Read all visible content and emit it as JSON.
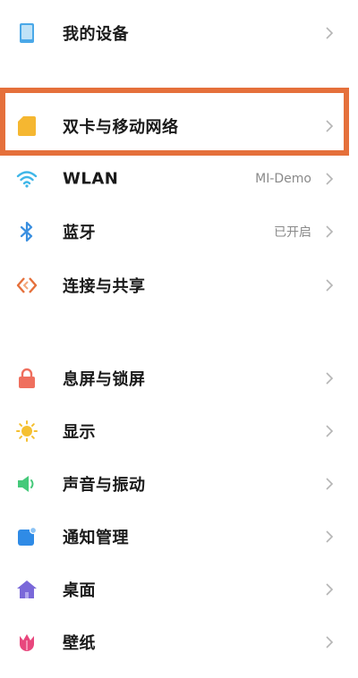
{
  "items": [
    {
      "icon": "device-icon",
      "label": "我的设备",
      "value": ""
    },
    {
      "icon": "sim-card-icon",
      "label": "双卡与移动网络",
      "value": ""
    },
    {
      "icon": "wifi-icon",
      "label": "WLAN",
      "value": "MI-Demo"
    },
    {
      "icon": "bluetooth-icon",
      "label": "蓝牙",
      "value": "已开启"
    },
    {
      "icon": "share-icon",
      "label": "连接与共享",
      "value": ""
    },
    {
      "icon": "lock-icon",
      "label": "息屏与锁屏",
      "value": ""
    },
    {
      "icon": "brightness-icon",
      "label": "显示",
      "value": ""
    },
    {
      "icon": "sound-icon",
      "label": "声音与振动",
      "value": ""
    },
    {
      "icon": "notification-icon",
      "label": "通知管理",
      "value": ""
    },
    {
      "icon": "home-icon",
      "label": "桌面",
      "value": ""
    },
    {
      "icon": "wallpaper-icon",
      "label": "壁纸",
      "value": ""
    }
  ],
  "colors": {
    "highlight": "#e5703b",
    "device": "#4aa8e8",
    "sim": "#f5b731",
    "wifi": "#3fb6e8",
    "bluetooth": "#3a8fe0",
    "share": "#e5703b",
    "lock": "#ef6f5e",
    "brightness": "#f5c032",
    "sound": "#45c97a",
    "notification": "#2f8be6",
    "home": "#7a68d9",
    "wallpaper": "#e8477d"
  }
}
